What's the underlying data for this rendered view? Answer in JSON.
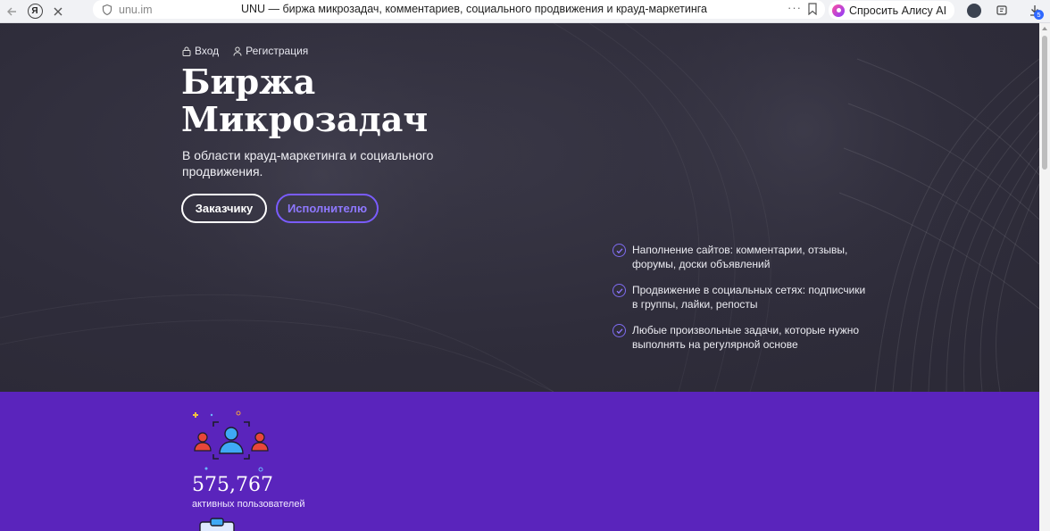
{
  "browser": {
    "url": "unu.im",
    "tab_title": "UNU — биржа микрозадач, комментариев, социального продвижения и крауд-маркетинга",
    "alice_label": "Спросить Алису AI",
    "yandex_logo": "Я",
    "downloads_badge": "5",
    "more_label": "···",
    "icons": [
      "back-icon",
      "yandex-logo-icon",
      "close-icon",
      "shield-icon",
      "more-icon",
      "bookmark-icon",
      "alice-icon",
      "extension-icon",
      "reader-icon",
      "download-icon"
    ]
  },
  "auth": {
    "login_label": "Вход",
    "register_label": "Регистрация"
  },
  "hero": {
    "title_line1": "Биржа",
    "title_line2": "Микрозадач",
    "lead": "В области крауд-маркетинга и социального продвижения.",
    "btn_client": "Заказчику",
    "btn_performer": "Исполнителю"
  },
  "features": [
    {
      "text": "Наполнение сайтов: комментарии, отзывы, форумы, доски объявлений"
    },
    {
      "text": "Продвижение в социальных сетях: подписчики в группы, лайки, репосты"
    },
    {
      "text": "Любые произвольные задачи, которые нужно выполнять на регулярной основе"
    }
  ],
  "stats": {
    "active_users_value": "575,767",
    "active_users_label": "активных пользователей"
  },
  "colors": {
    "hero_bg": "#2e2c3a",
    "stats_bg": "#5a24bc",
    "accent": "#7a5cff",
    "user_blue": "#3fa9f5",
    "user_red": "#e8463a"
  }
}
